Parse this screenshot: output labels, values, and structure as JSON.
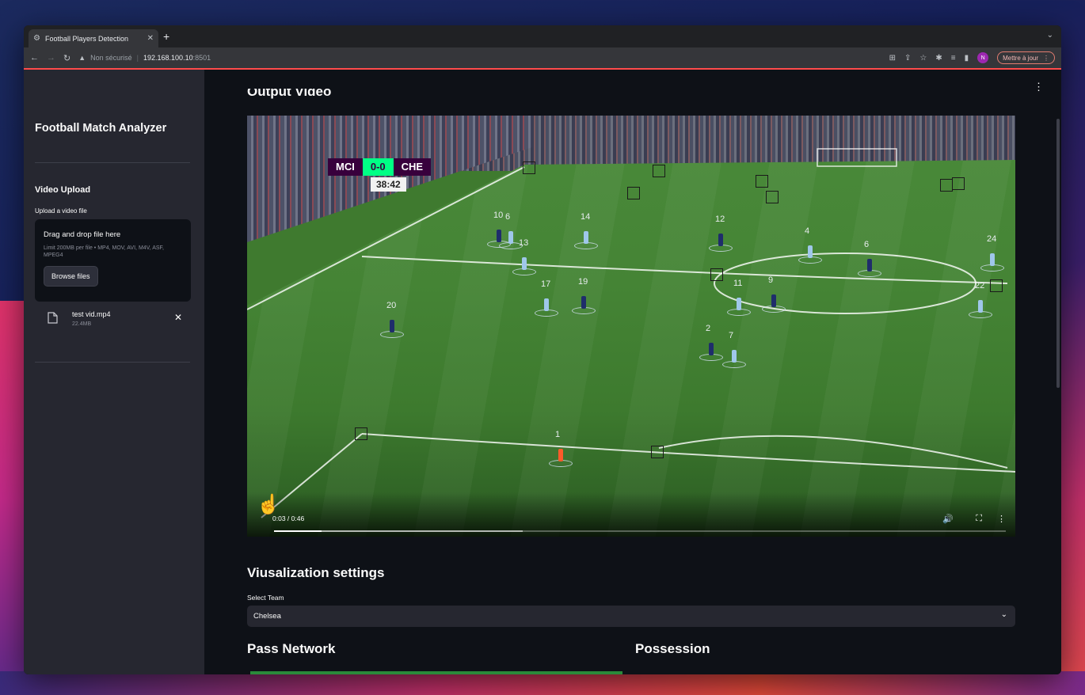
{
  "browser": {
    "tab_title": "Football Players Detection",
    "security_label": "Non sécurisé",
    "host": "192.168.100.10",
    "port": ":8501",
    "profile_initial": "N",
    "update_label": "Mettre à jour"
  },
  "sidebar": {
    "app_title": "Football Match Analyzer",
    "upload_header": "Video Upload",
    "upload_label": "Upload a video file",
    "dropzone_text": "Drag and drop file here",
    "limit_text": "Limit 200MB per file • MP4, MOV, AVI, M4V, ASF, MPEG4",
    "browse_label": "Browse files",
    "file_name": "test vid.mp4",
    "file_size": "22.4MB"
  },
  "main": {
    "output_title": "Output Video",
    "video": {
      "scoreboard": {
        "home": "MCI",
        "score": "0-0",
        "away": "CHE",
        "clock": "38:42"
      },
      "time_display": "0:03 / 0:46",
      "progress_fraction": 0.065,
      "player_numbers": [
        "10",
        "6",
        "14",
        "12",
        "4",
        "6",
        "24",
        "13",
        "17",
        "19",
        "11",
        "9",
        "22",
        "20",
        "2",
        "7",
        "1"
      ]
    },
    "viz_title": "Viusalization settings",
    "select_label": "Select Team",
    "select_value": "Chelsea",
    "pass_network_title": "Pass Network",
    "possession_title": "Possession"
  }
}
